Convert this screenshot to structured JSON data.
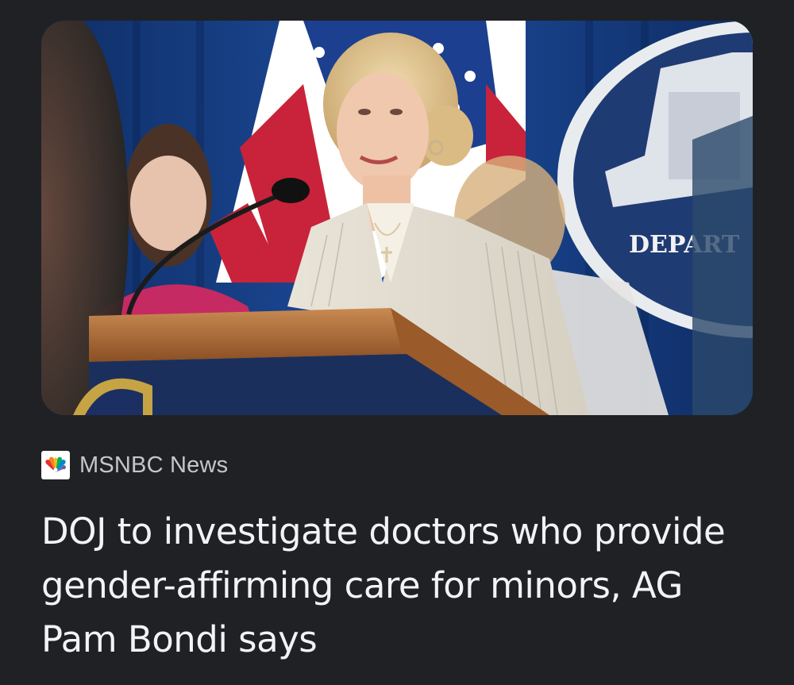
{
  "article": {
    "source": {
      "name": "MSNBC News",
      "logo_icon": "nbc-peacock-icon"
    },
    "headline": "DOJ to investigate doctors who provide gender-affirming care for minors, AG Pam Bondi says",
    "image": {
      "visible_text": "DEPART"
    }
  },
  "colors": {
    "background": "#202124",
    "headline_text": "#f1f3f4",
    "source_text": "#c4c7c9"
  }
}
